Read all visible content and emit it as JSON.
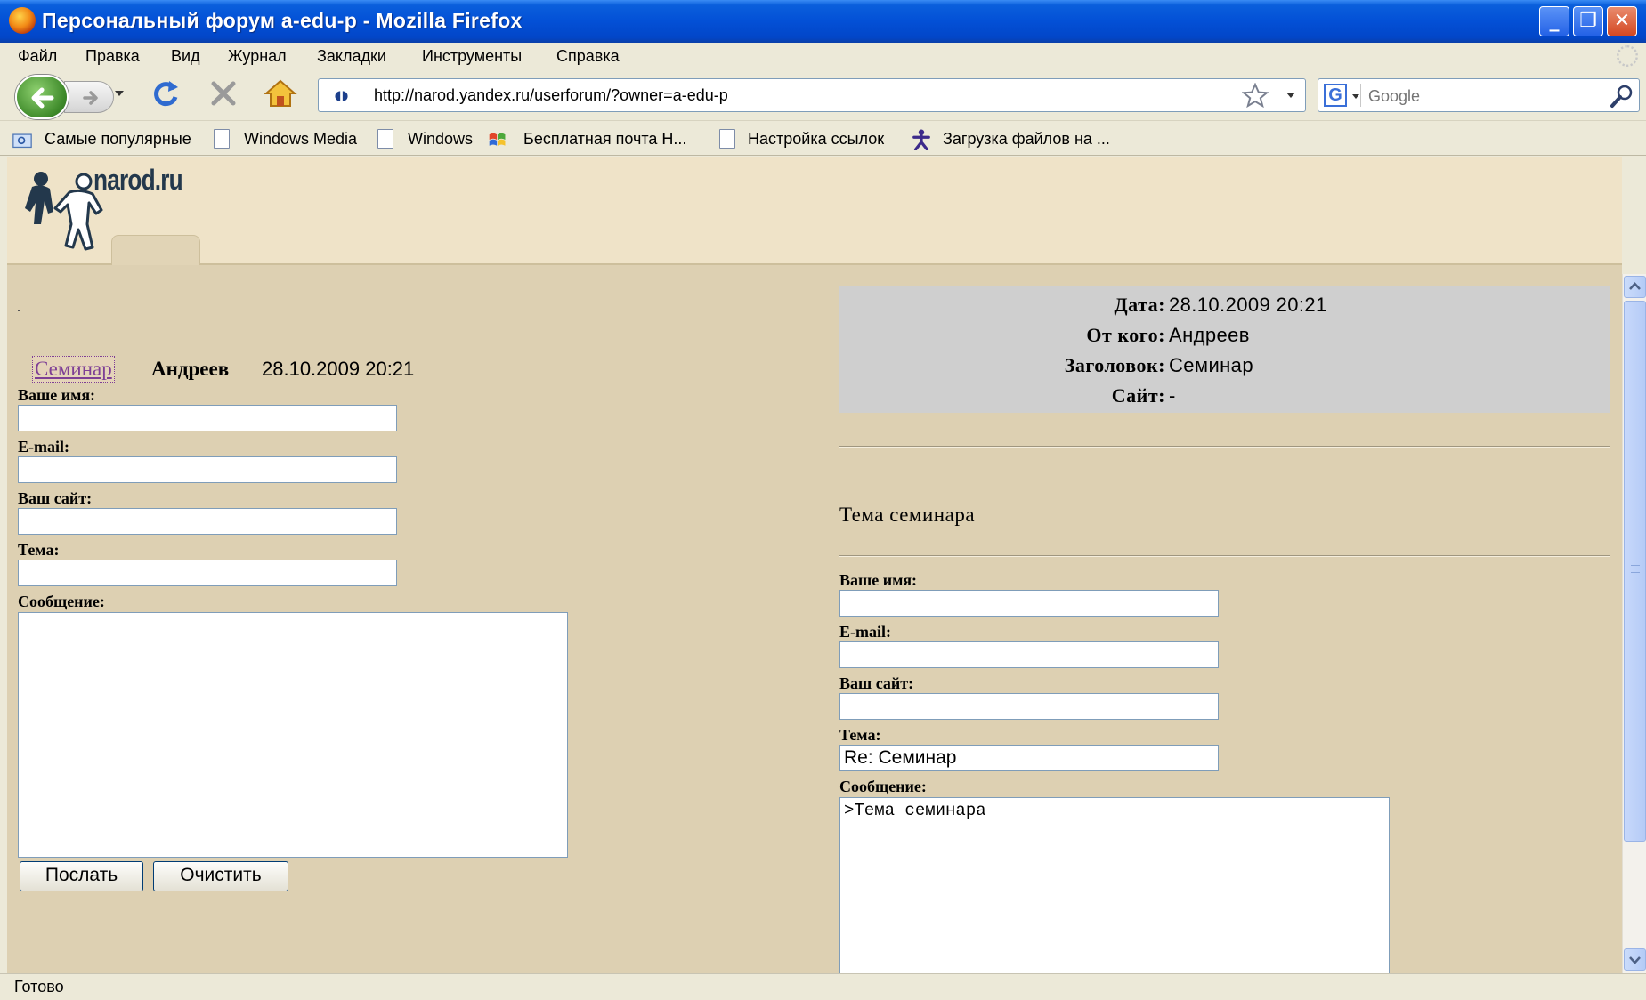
{
  "window": {
    "title": "Персональный форум a-edu-p - Mozilla Firefox"
  },
  "menu": [
    "Файл",
    "Правка",
    "Вид",
    "Журнал",
    "Закладки",
    "Инструменты",
    "Справка"
  ],
  "toolbar": {
    "url": "http://narod.yandex.ru/userforum/?owner=a-edu-p",
    "search_placeholder": "Google"
  },
  "bookmarks": [
    "Самые популярные",
    "Windows Media",
    "Windows",
    "Бесплатная почта Н...",
    "Настройка ссылок",
    "Загрузка файлов на ..."
  ],
  "page": {
    "logo_text": "narod.ru",
    "message_entry": {
      "topic_link": "Семинар",
      "author": "Андреев",
      "date": "28.10.2009 20:21"
    },
    "left_form": {
      "name_label": "Ваше имя:",
      "email_label": "E-mail:",
      "site_label": "Ваш сайт:",
      "topic_label": "Тема:",
      "message_label": "Сообщение:",
      "name_value": "",
      "email_value": "",
      "site_value": "",
      "topic_value": "",
      "message_value": "",
      "send_label": "Послать",
      "clear_label": "Очистить"
    },
    "message_info": {
      "date_label": "Дата:",
      "date_value": "28.10.2009 20:21",
      "from_label": "От кого:",
      "from_value": "Андреев",
      "subject_label": "Заголовок:",
      "subject_value": "Семинар",
      "site_label": "Сайт:",
      "site_value": "-"
    },
    "message_body": "Тема семинара",
    "reply_form": {
      "name_label": "Ваше имя:",
      "email_label": "E-mail:",
      "site_label": "Ваш сайт:",
      "topic_label": "Тема:",
      "message_label": "Сообщение:",
      "name_value": "",
      "email_value": "",
      "site_value": "",
      "topic_value": "Re: Семинар",
      "message_value": ">Тема семинара"
    }
  },
  "status": {
    "text": "Готово"
  },
  "colors": {
    "titlebar": "#0350d6",
    "page_background": "#ddd0b2",
    "header_background": "#efe3c8",
    "info_box": "#cfcfcf",
    "visited_link": "#7e3f95"
  }
}
